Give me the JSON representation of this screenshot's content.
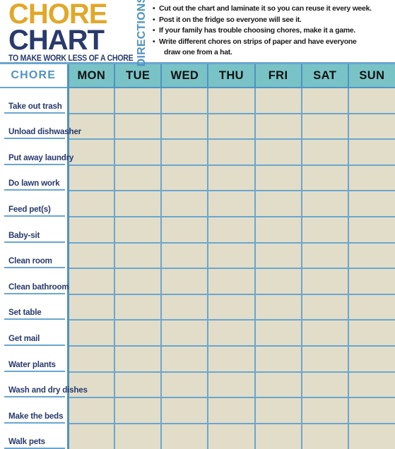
{
  "title": {
    "line1": "CHORE",
    "line2": "CHART",
    "tagline": "TO MAKE WORK LESS OF A CHORE",
    "color_line1": "#e0a82a",
    "color_line2": "#293a6b"
  },
  "directions": {
    "label": "DIRECTIONS",
    "label_color": "#4f93c4",
    "items": [
      "Cut out the chart and laminate it so you can reuse it every week.",
      "Post it on the fridge so everyone will see it.",
      "If your family has trouble choosing chores, make it a game.",
      "Write different chores on strips of paper and have everyone",
      "draw one from a hat."
    ]
  },
  "table": {
    "chore_header": "CHORE",
    "chore_header_color": "#4f93c4",
    "day_header_bg": "#79c3c6",
    "cell_bg": "#e2ddc8",
    "grid_color": "#6aa6cf",
    "days": [
      "MON",
      "TUE",
      "WED",
      "THU",
      "FRI",
      "SAT",
      "SUN"
    ],
    "chores": [
      "Take out trash",
      "Unload dishwasher",
      "Put away laundry",
      "Do lawn work",
      "Feed pet(s)",
      "Baby-sit",
      "Clean room",
      "Clean bathroom",
      "Set table",
      "Get mail",
      "Water plants",
      "Wash and dry dishes",
      "Make the beds",
      "Walk pets"
    ]
  }
}
